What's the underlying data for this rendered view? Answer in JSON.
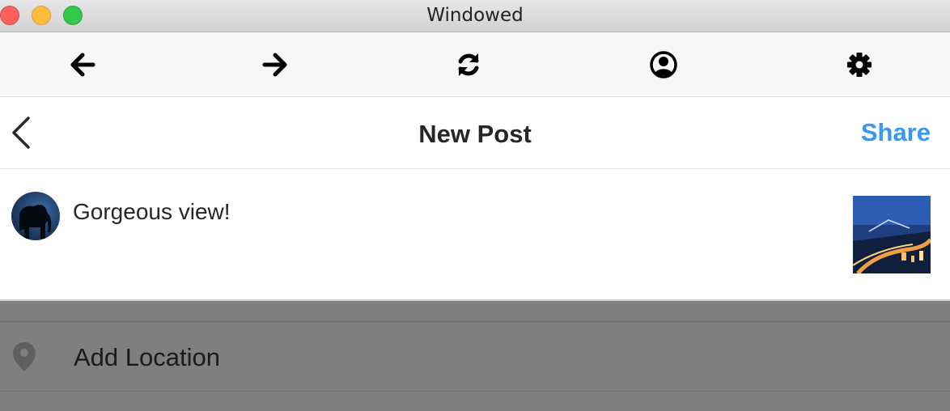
{
  "window": {
    "title": "Windowed",
    "controls": [
      "close",
      "minimize",
      "maximize"
    ]
  },
  "toolbar": {
    "buttons": [
      {
        "icon": "arrow-left-icon"
      },
      {
        "icon": "arrow-right-icon"
      },
      {
        "icon": "refresh-icon"
      },
      {
        "icon": "user-circle-icon"
      },
      {
        "icon": "gear-icon"
      }
    ]
  },
  "header": {
    "back_icon": "chevron-left-icon",
    "title": "New Post",
    "share_label": "Share",
    "accent_color": "#3897f0"
  },
  "composer": {
    "caption": "Gorgeous view!",
    "avatar_icon": "avatar",
    "thumbnail": "post-photo"
  },
  "location": {
    "label": "Add Location",
    "icon": "location-pin-icon"
  },
  "colors": {
    "overlay": "#7f7f7f",
    "text": "#262626"
  }
}
